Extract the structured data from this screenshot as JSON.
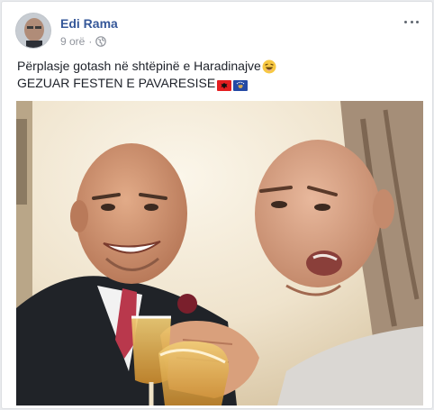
{
  "post": {
    "author": "Edi Rama",
    "time": "9 orë",
    "separator": "·",
    "audience_icon": "globe-icon",
    "more_icon": "more-options-icon",
    "text_line1": "Përplasje gotash në shtëpinë e Haradinajve",
    "text_line1_emoji": "laughing-face-emoji",
    "text_line2": "GEZUAR FESTEN E PAVARESISE",
    "text_line2_flags": [
      "flag-albania",
      "flag-kosovo"
    ]
  },
  "colors": {
    "link": "#365899",
    "meta": "#90949c",
    "text": "#1d2129",
    "albania_red": "#e41e20",
    "kosovo_blue": "#244aa5",
    "kosovo_gold": "#d0a650"
  }
}
